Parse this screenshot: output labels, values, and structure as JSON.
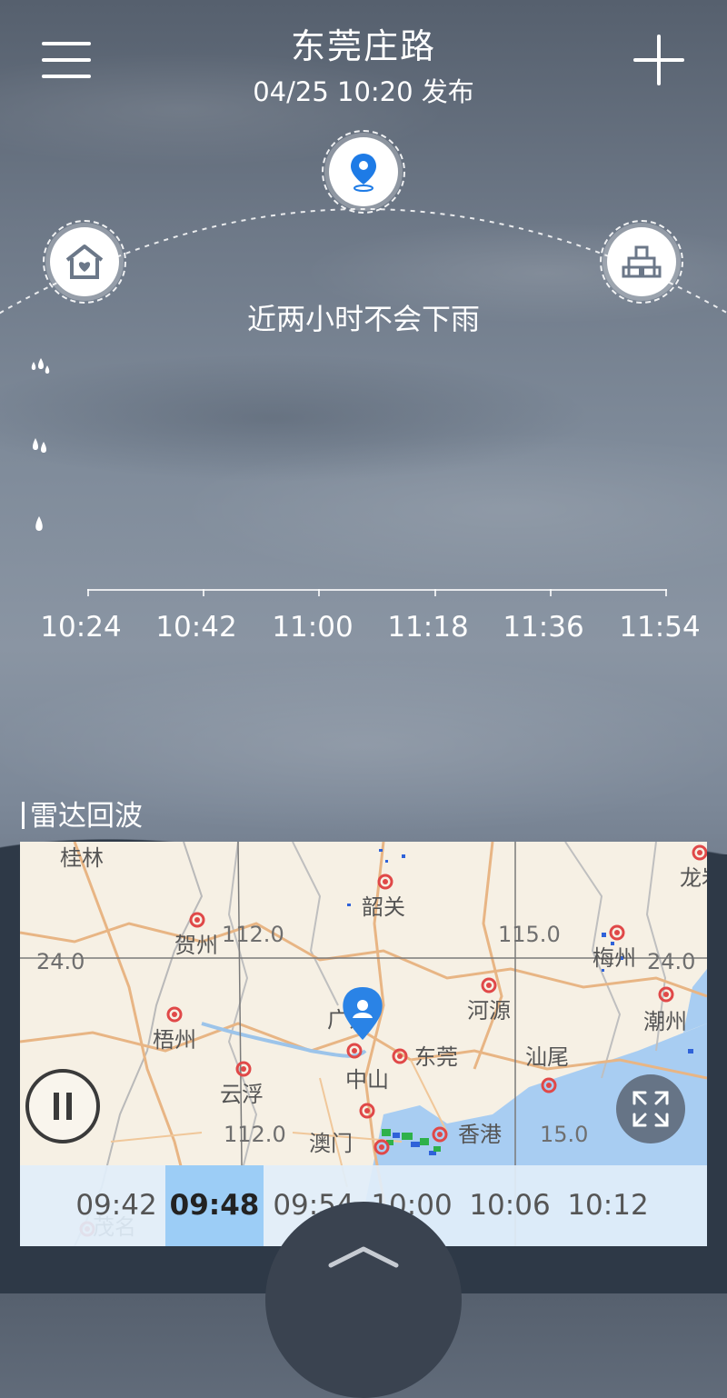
{
  "header": {
    "title": "东莞庄路",
    "published": "04/25  10:20 发布",
    "menu_icon": "menu-icon",
    "add_icon": "plus-icon"
  },
  "locations": [
    {
      "name": "home",
      "icon": "home-icon"
    },
    {
      "name": "current",
      "icon": "location-pin-icon"
    },
    {
      "name": "office",
      "icon": "building-icon"
    }
  ],
  "forecast": {
    "summary": "近两小时不会下雨",
    "times": [
      "10:24",
      "10:42",
      "11:00",
      "11:18",
      "11:36",
      "11:54"
    ],
    "intensity_icons": [
      "rain-drops-heavy-icon",
      "rain-drops-medium-icon",
      "rain-drop-light-icon"
    ]
  },
  "radar": {
    "section_title": "雷达回波",
    "map_labels": {
      "guilin": "桂林",
      "shaoguan": "韶关",
      "longyan": "龙岩",
      "hezhou": "贺州",
      "meizhou": "梅州",
      "heyuan": "河源",
      "chaozhou": "潮州",
      "wuzhou": "梧州",
      "guangzhou": "广州",
      "dongguan": "东莞",
      "shanwei": "汕尾",
      "yunfu": "云浮",
      "zhongshan": "中山",
      "macau": "澳门",
      "hongkong": "香港",
      "maoming": "茂名"
    },
    "grid_labels": {
      "lon_112_top": "112.0",
      "lon_115_top": "115.0",
      "lat_24_left": "24.0",
      "lat_24_right": "24.0",
      "lon_112_bottom": "112.0",
      "lon_115_bottom": "15.0"
    },
    "times": [
      "09:42",
      "09:48",
      "09:54",
      "10:00",
      "10:06",
      "10:12"
    ],
    "selected_time": "09:48",
    "play_icon": "pause-icon",
    "expand_icon": "expand-icon"
  },
  "bottom": {
    "pull_icon": "chevron-up-icon"
  }
}
